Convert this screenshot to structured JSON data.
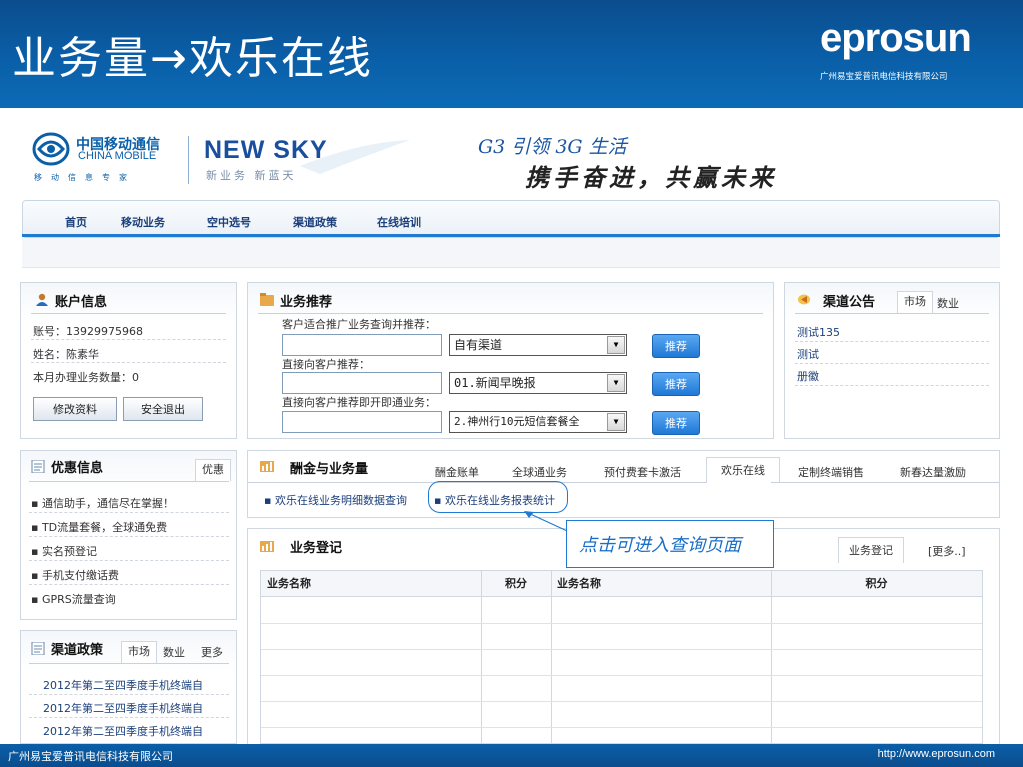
{
  "slide": {
    "title": "业务量→欢乐在线",
    "brand_logo": "eprosun",
    "brand_subtitle": "广州易宝爱普讯电信科技有限公司",
    "footer_left": "广州易宝爱普讯电信科技有限公司",
    "footer_right": "http://www.eprosun.com"
  },
  "site_header": {
    "cm_name_cn": "中国移动通信",
    "cm_name_en": "CHINA MOBILE",
    "cm_tagline": "移动信息专家",
    "ns_name": "NEW SKY",
    "ns_slogan": "新业务 新蓝天",
    "banner_line1": "G3 引领 3G 生活",
    "banner_line2": "携手奋进，共赢未来"
  },
  "nav": {
    "items": [
      "首页",
      "移动业务",
      "空中选号",
      "渠道政策",
      "在线培训"
    ]
  },
  "account": {
    "title": "账户信息",
    "account_no": "账号：13929975968",
    "name": "姓名：陈素华",
    "monthly_count": "本月办理业务数量：0",
    "edit_button": "修改资料",
    "logout_button": "安全退出"
  },
  "recommend": {
    "title": "业务推荐",
    "rows": [
      {
        "label": "客户适合推广业务查询并推荐：",
        "select": "自有渠道",
        "button": "推荐"
      },
      {
        "label": "直接向客户推荐：",
        "select": "01.新闻早晚报",
        "button": "推荐"
      },
      {
        "label": "直接向客户推荐即开即通业务：",
        "select": "2.神州行10元短信套餐全",
        "button": "推荐"
      }
    ]
  },
  "announce": {
    "title": "渠道公告",
    "tab_market": "市场",
    "tab_data": "数业",
    "items": [
      "测试135",
      "测试",
      "册徽"
    ]
  },
  "promo": {
    "title": "优惠信息",
    "tab": "优惠",
    "items": [
      "通信助手，通信尽在掌握！",
      "TD流量套餐，全球通免费",
      "实名预登记",
      "手机支付缴话费",
      "GPRS流量查询"
    ]
  },
  "policy": {
    "title": "渠道政策",
    "tab_market": "市场",
    "tab_data": "数业",
    "tab_more": "更多",
    "items": [
      "2012年第二至四季度手机终端自",
      "2012年第二至四季度手机终端自",
      "2012年第二至四季度手机终端自"
    ]
  },
  "commission": {
    "title": "酬金与业务量",
    "tabs": [
      "酬金账单",
      "全球通业务",
      "预付费套卡激活",
      "欢乐在线",
      "定制终端销售",
      "新春达量激励"
    ],
    "active_tab": "欢乐在线",
    "link_detail": "欢乐在线业务明细数据查询",
    "link_report": "欢乐在线业务报表统计"
  },
  "registry": {
    "title": "业务登记",
    "tab": "业务登记",
    "more": "[更多..]",
    "columns": [
      "业务名称",
      "积分",
      "业务名称",
      "积分"
    ]
  },
  "callout": {
    "text": "点击可进入查询页面"
  },
  "colors": {
    "header_blue": "#0a5fa8",
    "accent": "#1f7ad1"
  }
}
